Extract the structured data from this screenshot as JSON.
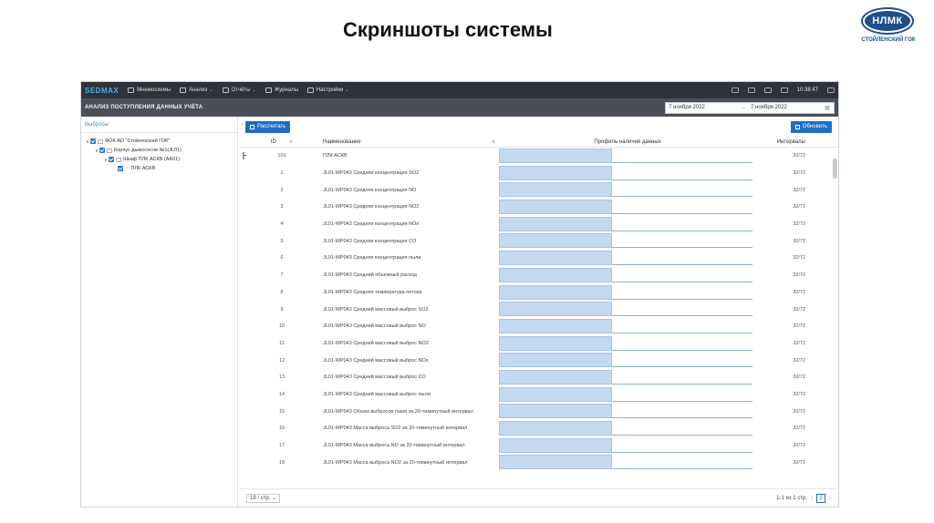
{
  "slide": {
    "title": "Скриншоты системы"
  },
  "logo": {
    "text": "НЛМК",
    "subtitle": "СТОЙЛЕНСКИЙ ГОК"
  },
  "app": {
    "brand": "SEDMAX",
    "nav": [
      {
        "label": "Мнемосхемы",
        "has_menu": false
      },
      {
        "label": "Анализ",
        "has_menu": true
      },
      {
        "label": "Отчёты",
        "has_menu": true
      },
      {
        "label": "Журналы",
        "has_menu": false
      },
      {
        "label": "Настройки",
        "has_menu": true
      }
    ],
    "time": "10:38:47",
    "page_title": "АНАЛИЗ ПОСТУПЛЕНИЯ ДАННЫХ УЧЁТА",
    "date_from": "7 ноября 2022",
    "date_to": "7 ноября 2022",
    "date_separator": "→",
    "sidebar": {
      "header": "Выбросы",
      "tree": [
        {
          "label": "ФОК АО \"Стойленский ГОК\"",
          "level": 0
        },
        {
          "label": "Корпус дымососов №1(JL01)",
          "level": 1
        },
        {
          "label": "Шкаф ПЛК АСКВ (АА01)",
          "level": 2
        },
        {
          "label": "ПЛК АСКВ",
          "level": 3
        }
      ]
    },
    "buttons": {
      "calculate": "Рассчитать",
      "refresh": "Обновить"
    },
    "table": {
      "headers": {
        "id": "ID",
        "name": "Наименование",
        "profile": "Профиль наличия данных",
        "intervals": "Интервалы"
      },
      "rows": [
        {
          "id": "101",
          "name": "ПЛК АСКВ",
          "intervals": "32/72",
          "group": true
        },
        {
          "id": "1",
          "name": "JL01-WP043 Средняя концентрация SO2",
          "intervals": "32/72"
        },
        {
          "id": "2",
          "name": "JL01-WP043 Средняя концентрация NO",
          "intervals": "32/72"
        },
        {
          "id": "3",
          "name": "JL01-WP043 Средняя концентрация NO2",
          "intervals": "32/72"
        },
        {
          "id": "4",
          "name": "JL01-WP043 Средняя концентрация NOx",
          "intervals": "32/72"
        },
        {
          "id": "5",
          "name": "JL01-WP043 Средняя концентрация CO",
          "intervals": "32/72"
        },
        {
          "id": "6",
          "name": "JL01-WP043 Средняя концентрация пыли",
          "intervals": "32/72"
        },
        {
          "id": "7",
          "name": "JL01-WP043 Средний объемный расход",
          "intervals": "32/72"
        },
        {
          "id": "8",
          "name": "JL01-WP043 Средняя температура потока",
          "intervals": "32/72"
        },
        {
          "id": "9",
          "name": "JL01-WP043 Средний массовый выброс SO2",
          "intervals": "32/72"
        },
        {
          "id": "10",
          "name": "JL01-WP043 Средний массовый выброс NO",
          "intervals": "32/72"
        },
        {
          "id": "11",
          "name": "JL01-WP043 Средний массовый выброс NO2",
          "intervals": "32/72"
        },
        {
          "id": "12",
          "name": "JL01-WP043 Средний массовый выброс NOx",
          "intervals": "32/72"
        },
        {
          "id": "13",
          "name": "JL01-WP043 Средний массовый выброс CO",
          "intervals": "32/72"
        },
        {
          "id": "14",
          "name": "JL01-WP043 Средний массовый выброс пыли",
          "intervals": "32/72"
        },
        {
          "id": "15",
          "name": "JL01-WP043 Объем выбросов газов за 20-тиминутный интервал",
          "intervals": "32/72"
        },
        {
          "id": "16",
          "name": "JL01-WP043 Масса выброса SO2 за 20-тиминутный интервал",
          "intervals": "32/72"
        },
        {
          "id": "17",
          "name": "JL01-WP043 Масса выброса NO за 20-тиминутный интервал",
          "intervals": "32/72"
        },
        {
          "id": "18",
          "name": "JL01-WP043 Масса выброса NO2 за 20-тиминутный интервал",
          "intervals": "32/72"
        }
      ]
    },
    "footer": {
      "per_page": "19 / стр.",
      "range": "1-1 из 1 стр.",
      "page": "1"
    }
  }
}
